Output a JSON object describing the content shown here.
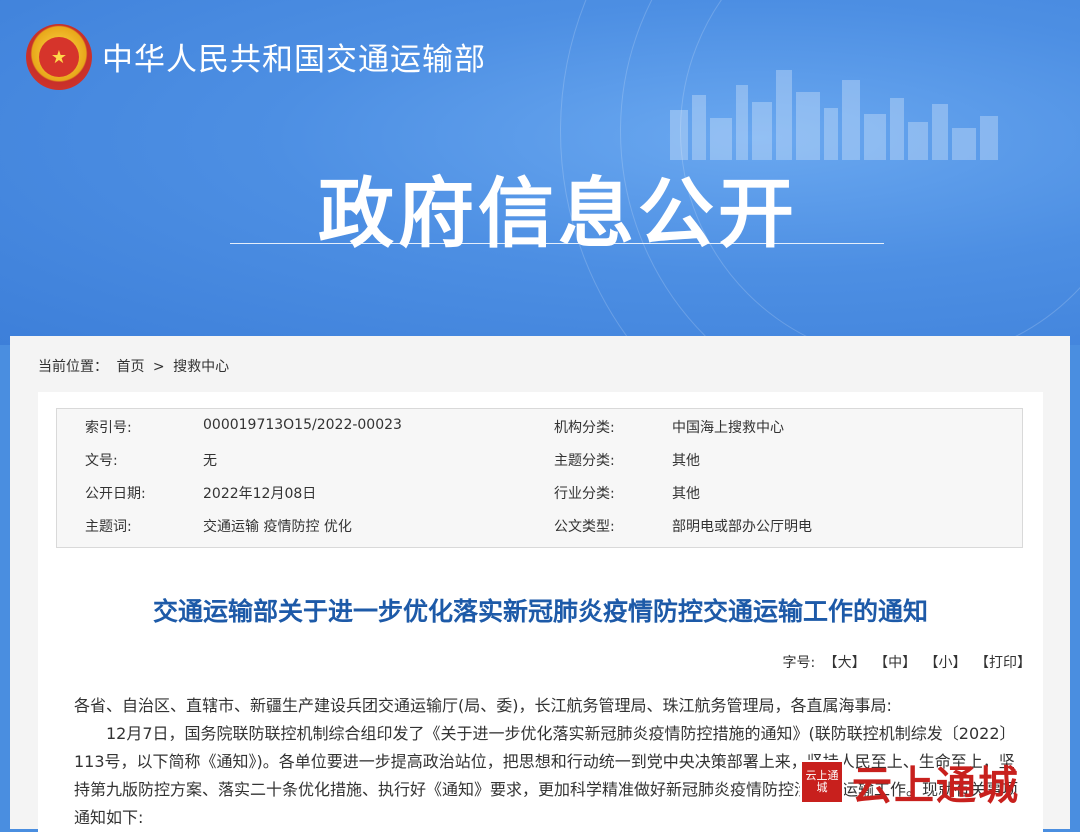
{
  "header": {
    "ministry_name": "中华人民共和国交通运输部",
    "banner_title": "政府信息公开"
  },
  "breadcrumb": {
    "prefix": "当前位置：",
    "home": "首页",
    "separator": ">",
    "current": "搜救中心"
  },
  "meta": {
    "index_label": "索引号:",
    "index_value": "000019713O15/2022-00023",
    "org_label": "机构分类:",
    "org_value": "中国海上搜救中心",
    "docno_label": "文号:",
    "docno_value": "无",
    "topic_label": "主题分类:",
    "topic_value": "其他",
    "date_label": "公开日期:",
    "date_value": "2022年12月08日",
    "industry_label": "行业分类:",
    "industry_value": "其他",
    "keywords_label": "主题词:",
    "keywords_value": "交通运输 疫情防控 优化",
    "doctype_label": "公文类型:",
    "doctype_value": "部明电或部办公厅明电"
  },
  "document": {
    "title": "交通运输部关于进一步优化落实新冠肺炎疫情防控交通运输工作的通知",
    "font_size_label": "字号:",
    "font_large": "【大】",
    "font_medium": "【中】",
    "font_small": "【小】",
    "print": "【打印】",
    "paragraph1": "各省、自治区、直辖市、新疆生产建设兵团交通运输厅(局、委)，长江航务管理局、珠江航务管理局，各直属海事局:",
    "paragraph2": "12月7日，国务院联防联控机制综合组印发了《关于进一步优化落实新冠肺炎疫情防控措施的通知》(联防联控机制综发〔2022〕113号，以下简称《通知》)。各单位要进一步提高政治站位，把思想和行动统一到党中央决策部署上来，坚持人民至上、生命至上，坚持第九版防控方案、落实二十条优化措施、执行好《通知》要求，更加科学精准做好新冠肺炎疫情防控涉交通运输工作。现就有关事项通知如下:"
  },
  "watermark": {
    "seal_text": "云上通城",
    "text": "云上通城"
  },
  "colors": {
    "banner_blue": "#4a8ee0",
    "title_blue": "#1d5aa8",
    "watermark_red": "#c8201d"
  }
}
